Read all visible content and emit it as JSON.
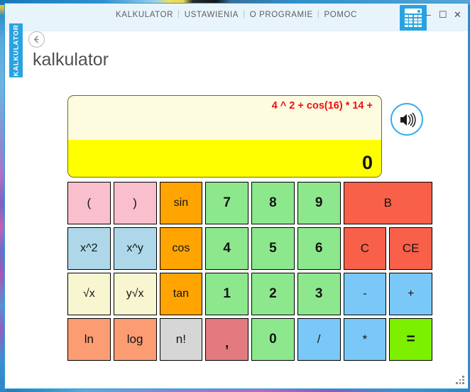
{
  "window": {
    "menu_items": [
      "KALKULATOR",
      "USTAWIENIA",
      "O PROGRAMIE",
      "POMOC"
    ],
    "menu_separator": "|",
    "app_icon": "calculator-icon",
    "minimize": "–",
    "maximize": "☐",
    "close": "✕"
  },
  "side_tab": {
    "label": "KALKULATOR"
  },
  "header": {
    "back_icon": "back-arrow-icon",
    "title": "kalkulator"
  },
  "display": {
    "expression": "4 ^ 2 + cos(16)  * 14 +",
    "result": "0",
    "expression_color": "#ee1010",
    "result_band_color": "#ffff00",
    "panel_color": "#fdfbe0"
  },
  "sound_button": {
    "icon": "speaker-icon",
    "accent": "#35aeea"
  },
  "keypad": {
    "rows": [
      [
        {
          "label": "(",
          "name": "key-open-paren",
          "color": "#f9bfcd",
          "span": 1,
          "style": ""
        },
        {
          "label": ")",
          "name": "key-close-paren",
          "color": "#f9bfcd",
          "span": 1,
          "style": ""
        },
        {
          "label": "sin",
          "name": "key-sin",
          "color": "#ffa400",
          "span": 1,
          "style": "small"
        },
        {
          "label": "7",
          "name": "key-7",
          "color": "#8de88d",
          "span": 1,
          "style": "num"
        },
        {
          "label": "8",
          "name": "key-8",
          "color": "#8de88d",
          "span": 1,
          "style": "num"
        },
        {
          "label": "9",
          "name": "key-9",
          "color": "#8de88d",
          "span": 1,
          "style": "num"
        },
        {
          "label": "B",
          "name": "key-backspace",
          "color": "#f8604a",
          "span": 2,
          "style": ""
        }
      ],
      [
        {
          "label": "x^2",
          "name": "key-x-squared",
          "color": "#aed8ea",
          "span": 1,
          "style": "small"
        },
        {
          "label": "x^y",
          "name": "key-x-power-y",
          "color": "#aed8ea",
          "span": 1,
          "style": "small"
        },
        {
          "label": "cos",
          "name": "key-cos",
          "color": "#ffa400",
          "span": 1,
          "style": "small"
        },
        {
          "label": "4",
          "name": "key-4",
          "color": "#8de88d",
          "span": 1,
          "style": "num"
        },
        {
          "label": "5",
          "name": "key-5",
          "color": "#8de88d",
          "span": 1,
          "style": "num"
        },
        {
          "label": "6",
          "name": "key-6",
          "color": "#8de88d",
          "span": 1,
          "style": "num"
        },
        {
          "label": "C",
          "name": "key-clear",
          "color": "#f8604a",
          "span": 1,
          "style": ""
        },
        {
          "label": "CE",
          "name": "key-clear-entry",
          "color": "#f8604a",
          "span": 1,
          "style": ""
        }
      ],
      [
        {
          "label": "√x",
          "name": "key-sqrt",
          "color": "#f7f6d0",
          "span": 1,
          "style": "small"
        },
        {
          "label": "y√x",
          "name": "key-nth-root",
          "color": "#f7f6d0",
          "span": 1,
          "style": "small"
        },
        {
          "label": "tan",
          "name": "key-tan",
          "color": "#ffa400",
          "span": 1,
          "style": "small"
        },
        {
          "label": "1",
          "name": "key-1",
          "color": "#8de88d",
          "span": 1,
          "style": "num"
        },
        {
          "label": "2",
          "name": "key-2",
          "color": "#8de88d",
          "span": 1,
          "style": "num"
        },
        {
          "label": "3",
          "name": "key-3",
          "color": "#8de88d",
          "span": 1,
          "style": "num"
        },
        {
          "label": "-",
          "name": "key-minus",
          "color": "#79c8f7",
          "span": 1,
          "style": "small"
        },
        {
          "label": "+",
          "name": "key-plus",
          "color": "#79c8f7",
          "span": 1,
          "style": "small"
        }
      ],
      [
        {
          "label": "ln",
          "name": "key-ln",
          "color": "#fb9c73",
          "span": 1,
          "style": ""
        },
        {
          "label": "log",
          "name": "key-log",
          "color": "#fb9c73",
          "span": 1,
          "style": ""
        },
        {
          "label": "n!",
          "name": "key-factorial",
          "color": "#d6d6d6",
          "span": 1,
          "style": ""
        },
        {
          "label": ",",
          "name": "key-decimal-comma",
          "color": "#e37a80",
          "span": 1,
          "style": "comma"
        },
        {
          "label": "0",
          "name": "key-0",
          "color": "#8de88d",
          "span": 1,
          "style": "num"
        },
        {
          "label": "/",
          "name": "key-divide",
          "color": "#79c8f7",
          "span": 1,
          "style": ""
        },
        {
          "label": "*",
          "name": "key-multiply",
          "color": "#79c8f7",
          "span": 1,
          "style": ""
        },
        {
          "label": "=",
          "name": "key-equals",
          "color": "#7cf000",
          "span": 1,
          "style": "eq"
        }
      ]
    ]
  }
}
